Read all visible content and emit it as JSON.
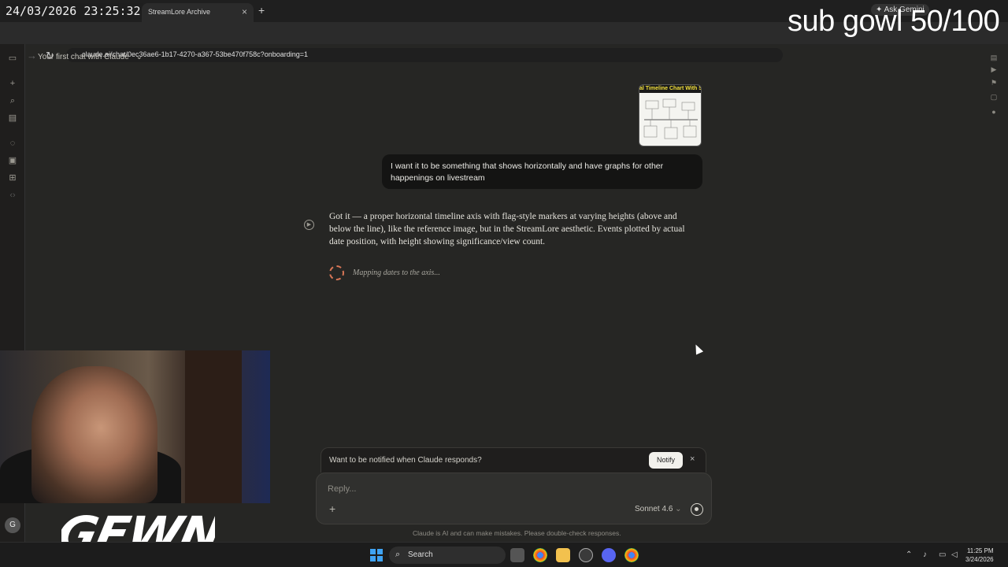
{
  "browser": {
    "overlay_datetime": "24/03/2026 23:25:32",
    "active_tab": "StreamLore Archive",
    "url": "claude.ai/chat/0ec36ae6-1b17-4270-a367-53be470f758c?onboarding=1",
    "ask_gemini": "Ask Gemini"
  },
  "stream_overlay": {
    "subgoal": "sub gowl 50/100",
    "logo_text": "GEWN"
  },
  "chat": {
    "title": "Your first chat with Claude",
    "attachment_title": "al Timeline Chart With Scat",
    "user_message": "I want it to be something that shows horizontally and have graphs for other happenings on livestream",
    "assistant_message": "Got it — a proper horizontal timeline axis with flag-style markers at varying heights (above and below the line), like the reference image, but in the StreamLore aesthetic. Events plotted by actual date position, with height showing significance/view count.",
    "status": "Mapping dates to the axis..."
  },
  "notify": {
    "prompt": "Want to be notified when Claude responds?",
    "button": "Notify",
    "close": "×"
  },
  "composer": {
    "placeholder": "Reply...",
    "plus": "+",
    "model": "Sonnet 4.6",
    "model_caret": "⌄",
    "disclaimer": "Claude is AI and can make mistakes. Please double-check responses."
  },
  "taskbar": {
    "search": "Search",
    "time": "11:25 PM",
    "date": "3/24/2026",
    "user_initial": "G"
  },
  "colors": {
    "background": "#262624",
    "accent": "#d97757",
    "user_bubble": "#141413"
  }
}
